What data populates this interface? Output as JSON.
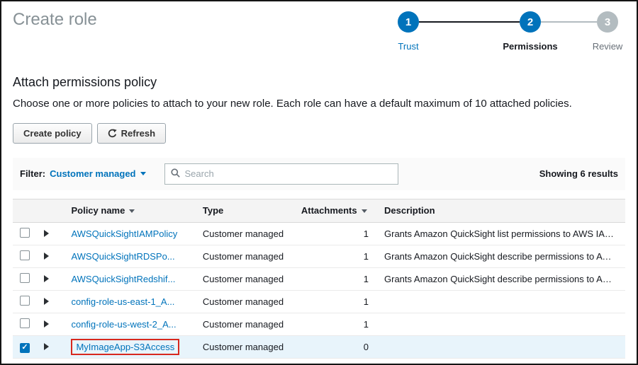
{
  "page": {
    "title": "Create role"
  },
  "colors": {
    "accent_blue": "#0073bb",
    "step_inactive": "#b3bcc0",
    "annotation_red": "#d8281e",
    "selected_row_bg": "#e8f4fb"
  },
  "steps": {
    "items": [
      {
        "number": "1",
        "label": "Trust"
      },
      {
        "number": "2",
        "label": "Permissions"
      },
      {
        "number": "3",
        "label": "Review"
      }
    ]
  },
  "section": {
    "heading": "Attach permissions policy",
    "description": "Choose one or more policies to attach to your new role. Each role can have a default maximum of 10 attached policies."
  },
  "toolbar": {
    "create_policy_label": "Create policy",
    "refresh_label": "Refresh"
  },
  "filter": {
    "label": "Filter:",
    "selected_value": "Customer managed",
    "search_placeholder": "Search",
    "results_text": "Showing 6 results"
  },
  "table": {
    "headers": [
      "Policy name",
      "Type",
      "Attachments",
      "Description"
    ],
    "rows": [
      {
        "name": "AWSQuickSightIAMPolicy",
        "type": "Customer managed",
        "attachments": "1",
        "description": "Grants Amazon QuickSight list permissions to AWS IAM r..."
      },
      {
        "name": "AWSQuickSightRDSPo...",
        "type": "Customer managed",
        "attachments": "1",
        "description": "Grants Amazon QuickSight describe permissions to AWS ..."
      },
      {
        "name": "AWSQuickSightRedshif...",
        "type": "Customer managed",
        "attachments": "1",
        "description": "Grants Amazon QuickSight describe permissions to Amaz..."
      },
      {
        "name": "config-role-us-east-1_A...",
        "type": "Customer managed",
        "attachments": "1",
        "description": ""
      },
      {
        "name": "config-role-us-west-2_A...",
        "type": "Customer managed",
        "attachments": "1",
        "description": ""
      },
      {
        "name": "MyImageApp-S3Access",
        "type": "Customer managed",
        "attachments": "0",
        "description": ""
      }
    ]
  }
}
